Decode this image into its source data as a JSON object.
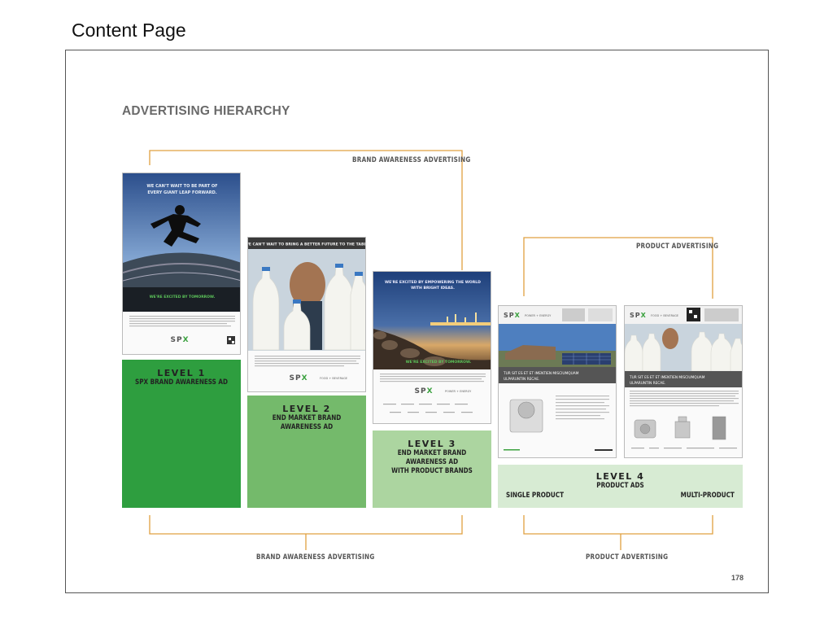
{
  "slide": {
    "title": "Content Page"
  },
  "document": {
    "heading": "ADVERTISING HIERARCHY",
    "page_number": "178",
    "top_labels": {
      "brand": "BRAND AWARENESS ADVERTISING",
      "product": "PRODUCT ADVERTISING"
    },
    "bottom_labels": {
      "brand": "BRAND AWARENESS ADVERTISING",
      "product": "PRODUCT ADVERTISING"
    },
    "levels": [
      {
        "num": "LEVEL 1",
        "line1": "SPX BRAND AWARENESS AD",
        "line2": "",
        "color": "#2e9e3f"
      },
      {
        "num": "LEVEL 2",
        "line1": "END MARKET BRAND AWARENESS AD",
        "line2": "",
        "color": "#74ba6b"
      },
      {
        "num": "LEVEL 3",
        "line1": "END MARKET BRAND AWARENESS AD",
        "line2": "WITH PRODUCT BRANDS",
        "color": "#acd5a0"
      },
      {
        "num": "LEVEL 4",
        "line1": "PRODUCT ADS",
        "line2": "",
        "color": "#d7ebd3"
      }
    ],
    "level4_left": "SINGLE PRODUCT",
    "level4_right": "MULTI-PRODUCT",
    "ads": {
      "ad1": {
        "headline": "WE CAN'T WAIT TO BE PART OF EVERY GIANT LEAP FORWARD.",
        "tagline": "WE'RE EXCITED BY TOMORROW.",
        "logo": "SPX"
      },
      "ad2": {
        "headline": "WE CAN'T WAIT TO BRING A BETTER FUTURE TO THE TABLE.",
        "logo": "SPX",
        "division": "FOOD + BEVERAGE"
      },
      "ad3": {
        "headline": "WE'RE EXCITED BY EMPOWERING THE WORLD WITH BRIGHT IDEAS.",
        "tagline": "WE'RE EXCITED BY TOMORROW.",
        "logo": "SPX",
        "division": "POWER + ENERGY"
      },
      "ad4": {
        "logo": "SPX",
        "division": "POWER + ENERGY",
        "band": "TUR SIT ES ET ET IMENTIEN MISCIUMQUAM ULPARUNTIN RECAE."
      },
      "ad5": {
        "logo": "SPX",
        "division": "FOOD + BEVERAGE",
        "band": "TUR SIT ES ET ET IMENTIEN MISCIUMQUAM ULPARUNTIN RECAE."
      }
    },
    "colors": {
      "bracket": "#e0a040",
      "dark_green": "#2e9e3f"
    }
  }
}
